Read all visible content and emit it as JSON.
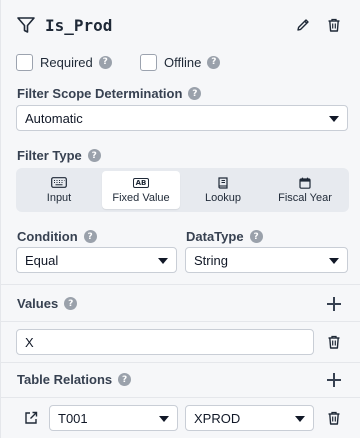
{
  "header": {
    "title": "Is_Prod",
    "icons": [
      "filter-icon",
      "pencil-icon",
      "trash-icon"
    ]
  },
  "flags": {
    "required_label": "Required",
    "offline_label": "Offline",
    "help_glyph": "?"
  },
  "scope": {
    "label": "Filter Scope Determination",
    "value": "Automatic"
  },
  "filter_type": {
    "label": "Filter Type",
    "options": [
      {
        "label": "Input",
        "icon": "keyboard-icon"
      },
      {
        "label": "Fixed Value",
        "icon": "ab-icon",
        "icon_text": "AB"
      },
      {
        "label": "Lookup",
        "icon": "book-icon"
      },
      {
        "label": "Fiscal Year",
        "icon": "calendar-icon"
      }
    ],
    "selected": "Fixed Value"
  },
  "condition": {
    "label": "Condition",
    "value": "Equal"
  },
  "datatype": {
    "label": "DataType",
    "value": "String"
  },
  "values": {
    "label": "Values",
    "items": [
      "X"
    ]
  },
  "table_relations": {
    "label": "Table Relations",
    "rows": [
      {
        "table": "T001",
        "field": "XPROD"
      }
    ]
  },
  "colors": {
    "panel_bg": "#f6f7f9",
    "segment_bg": "#e7eaef",
    "help_bg": "#9aa1ab"
  }
}
